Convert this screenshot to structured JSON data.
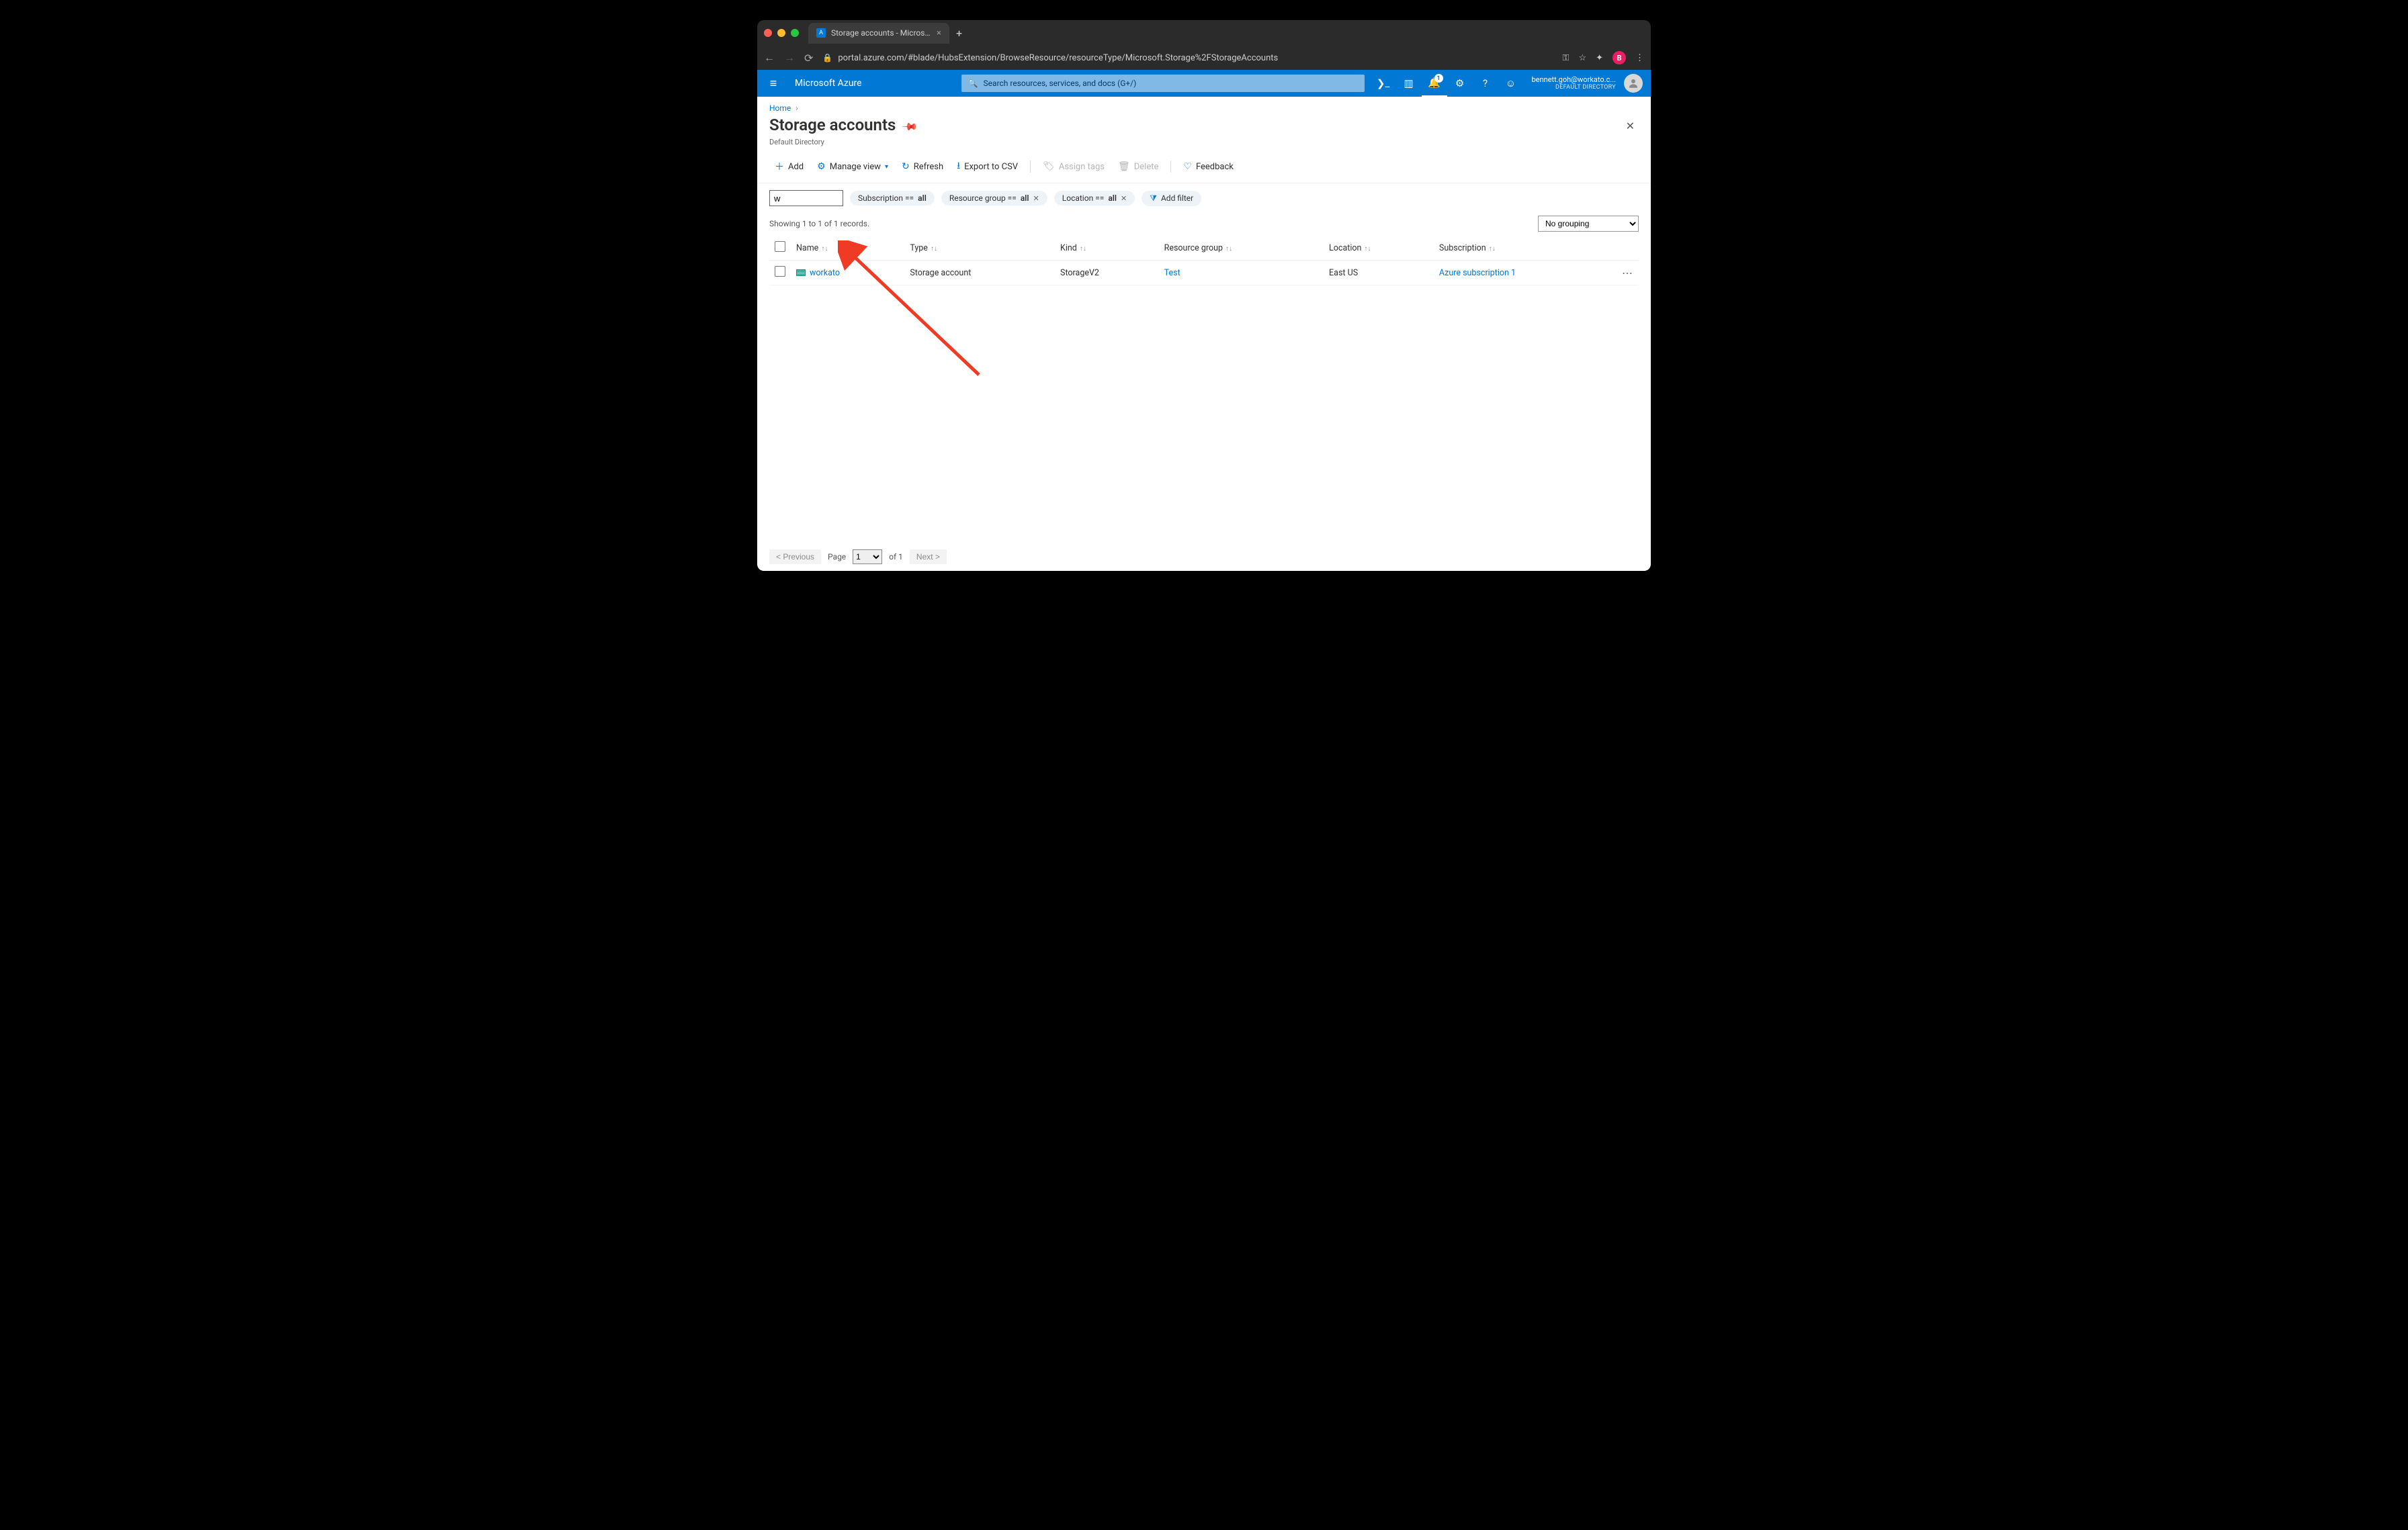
{
  "browser": {
    "tab_title": "Storage accounts - Microsoft A",
    "url": "portal.azure.com/#blade/HubsExtension/BrowseResource/resourceType/Microsoft.Storage%2FStorageAccounts",
    "avatar_initial": "B"
  },
  "header": {
    "brand": "Microsoft Azure",
    "search_placeholder": "Search resources, services, and docs (G+/)",
    "notification_count": "1",
    "user_email": "bennett.goh@workato.c...",
    "directory": "DEFAULT DIRECTORY"
  },
  "breadcrumb": {
    "home": "Home"
  },
  "blade": {
    "title": "Storage accounts",
    "subtitle": "Default Directory",
    "commands": {
      "add": "Add",
      "manage_view": "Manage view",
      "refresh": "Refresh",
      "export_csv": "Export to CSV",
      "assign_tags": "Assign tags",
      "delete": "Delete",
      "feedback": "Feedback"
    }
  },
  "filters": {
    "input_value": "w",
    "subscription": {
      "label": "Subscription == ",
      "value": "all"
    },
    "resource_group": {
      "label": "Resource group == ",
      "value": "all"
    },
    "location": {
      "label": "Location == ",
      "value": "all"
    },
    "add_filter": "Add filter"
  },
  "records_text": "Showing 1 to 1 of 1 records.",
  "grouping_value": "No grouping",
  "columns": {
    "name": "Name",
    "type": "Type",
    "kind": "Kind",
    "rg": "Resource group",
    "location": "Location",
    "subscription": "Subscription"
  },
  "rows": [
    {
      "name": "workato",
      "type": "Storage account",
      "kind": "StorageV2",
      "rg": "Test",
      "location": "East US",
      "subscription": "Azure subscription 1"
    }
  ],
  "pager": {
    "prev": "< Previous",
    "page_label": "Page",
    "page": "1",
    "of": "of 1",
    "next": "Next >"
  }
}
